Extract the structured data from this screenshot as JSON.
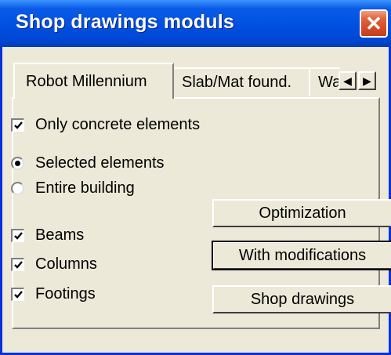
{
  "window": {
    "title": "Shop drawings moduls"
  },
  "tabs": [
    {
      "label": "Robot Millennium",
      "active": true
    },
    {
      "label": "Slab/Mat found.",
      "active": false
    },
    {
      "label": "Wa",
      "active": false
    }
  ],
  "tab_scroll": {
    "left": "◀",
    "right": "▶"
  },
  "options": {
    "only_concrete": {
      "label": "Only concrete elements",
      "checked": true
    },
    "selection": {
      "selected_label": "Selected elements",
      "entire_label": "Entire building",
      "value": "Selected elements"
    },
    "beams": {
      "label": "Beams",
      "checked": true
    },
    "columns": {
      "label": "Columns",
      "checked": true
    },
    "footings": {
      "label": "Footings",
      "checked": true
    }
  },
  "buttons": {
    "optimization": "Optimization",
    "with_modifications": "With modifications",
    "shop_drawings": "Shop drawings"
  },
  "colors": {
    "titlebar": "#0050e0",
    "close": "#d44a24",
    "face": "#ece9d8"
  }
}
